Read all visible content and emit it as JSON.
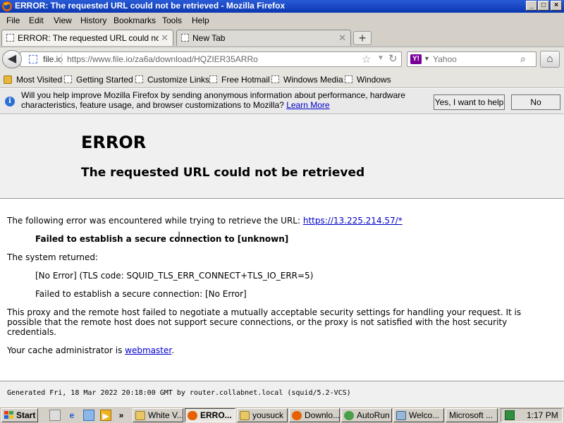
{
  "window": {
    "title": "ERROR: The requested URL could not be retrieved - Mozilla Firefox",
    "controls": [
      "_",
      "□",
      "×"
    ]
  },
  "menu": [
    "File",
    "Edit",
    "View",
    "History",
    "Bookmarks",
    "Tools",
    "Help"
  ],
  "tabs": [
    {
      "label": "ERROR: The requested URL could not be...",
      "active": true
    },
    {
      "label": "New Tab",
      "active": false
    }
  ],
  "nav": {
    "domain": "file.io",
    "url": "https://www.file.io/za6a/download/HQZIER35ARRo",
    "search_engine": "Yahoo",
    "search_placeholder": "Yahoo"
  },
  "bookmarks": [
    "Most Visited",
    "Getting Started",
    "Customize Links",
    "Free Hotmail",
    "Windows Media",
    "Windows"
  ],
  "notification": {
    "message": "Will you help improve Mozilla Firefox by sending anonymous information about performance, hardware characteristics, feature usage, and browser customizations to Mozilla?",
    "learn_more": "Learn More",
    "yes_button": "Yes, I want to help",
    "no_button": "No"
  },
  "page": {
    "heading": "ERROR",
    "subheading": "The requested URL could not be retrieved",
    "intro": "The following error was encountered while trying to retrieve the URL:",
    "error_url": "https://13.225.214.57/*",
    "failed": "Failed to establish a secure connection to [unknown]",
    "system_returned": "The system returned:",
    "tls_code": "[No Error] (TLS code: SQUID_TLS_ERR_CONNECT+TLS_IO_ERR=5)",
    "failed_detail": "Failed to establish a secure connection: [No Error]",
    "explanation": "This proxy and the remote host failed to negotiate a mutually acceptable security settings for handling your request. It is possible that the remote host does not support secure connections, or the proxy is not satisfied with the host security credentials.",
    "admin_prefix": "Your cache administrator is",
    "admin_link": "webmaster",
    "admin_suffix": ".",
    "footer": "Generated Fri, 18 Mar 2022 20:18:00 GMT by router.collabnet.local (squid/5.2-VCS)"
  },
  "taskbar": {
    "start": "Start",
    "items": [
      {
        "label": "White V...",
        "icon": "folder-icon",
        "active": false
      },
      {
        "label": "ERRO...",
        "icon": "firefox-icon",
        "active": true
      },
      {
        "label": "yousuck",
        "icon": "folder-icon",
        "active": false
      },
      {
        "label": "Downlo...",
        "icon": "firefox-icon",
        "active": false
      },
      {
        "label": "AutoRun",
        "icon": "autorun-icon",
        "active": false
      },
      {
        "label": "Welco...",
        "icon": "welcome-icon",
        "active": false
      },
      {
        "label": "Microsoft ...",
        "icon": "app-icon",
        "active": false
      }
    ],
    "clock": "1:17 PM"
  }
}
